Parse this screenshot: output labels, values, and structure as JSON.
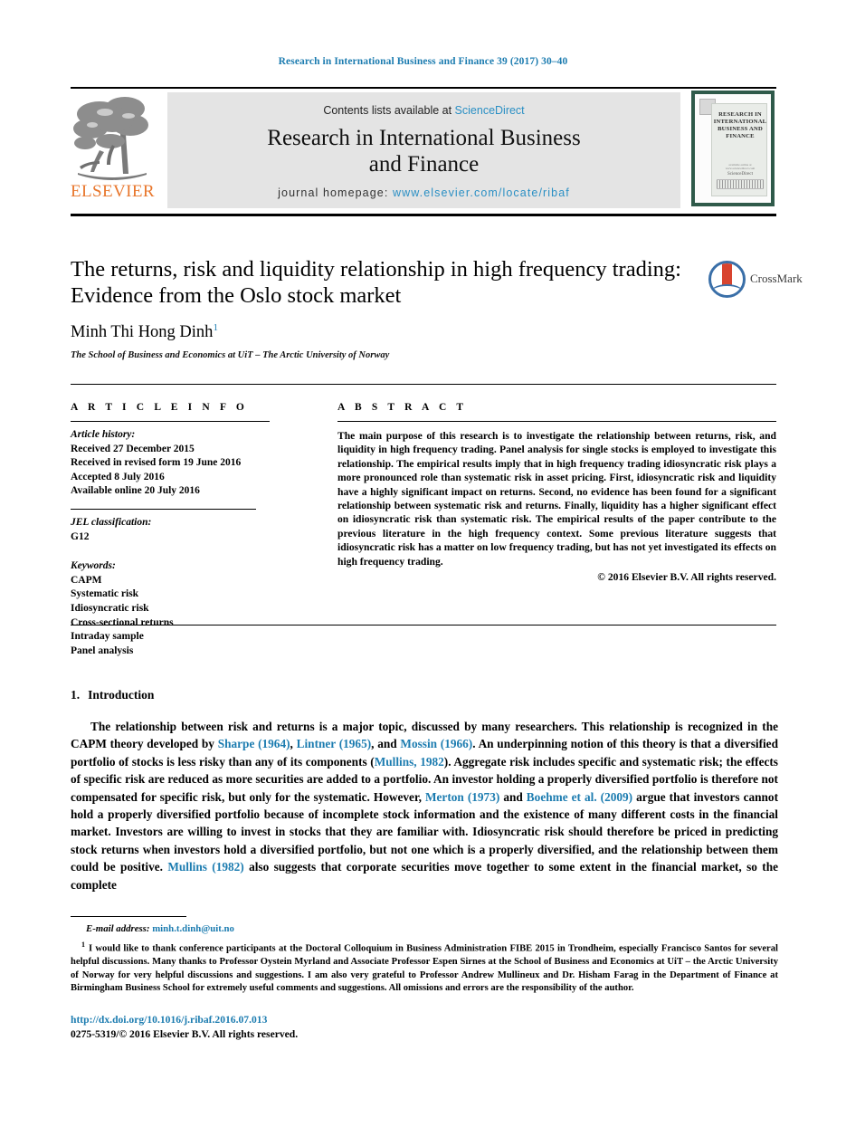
{
  "running_head": "Research in International Business and Finance 39 (2017) 30–40",
  "masthead": {
    "publisher_name": "ELSEVIER",
    "contents_prefix": "Contents lists available at ",
    "contents_link": "ScienceDirect",
    "journal_title_line1": "Research in International Business",
    "journal_title_line2": "and Finance",
    "homepage_prefix": "journal homepage: ",
    "homepage_url": "www.elsevier.com/locate/ribaf",
    "cover": {
      "title_line1": "RESEARCH IN",
      "title_line2": "INTERNATIONAL",
      "title_line3": "BUSINESS AND",
      "title_line4": "FINANCE",
      "footer_tiny": "available online at www.sciencedirect.com",
      "footer_sciencedirect": "ScienceDirect"
    }
  },
  "article": {
    "title": "The returns, risk and liquidity relationship in high frequency trading: Evidence from the Oslo stock market",
    "author": "Minh Thi Hong Dinh",
    "author_footnote_marker": "1",
    "affiliation": "The School of Business and Economics at UiT – The Arctic University of Norway",
    "crossmark_label": "CrossMark"
  },
  "article_info": {
    "heading": "A R T I C L E   I N F O",
    "history_label": "Article history:",
    "history": [
      "Received 27 December 2015",
      "Received in revised form 19 June 2016",
      "Accepted 8 July 2016",
      "Available online 20 July 2016"
    ],
    "jel_label": "JEL classification:",
    "jel_codes": [
      "G12"
    ],
    "keywords_label": "Keywords:",
    "keywords": [
      "CAPM",
      "Systematic risk",
      "Idiosyncratic risk",
      "Cross-sectional returns",
      "Intraday sample",
      "Panel analysis"
    ]
  },
  "abstract": {
    "heading": "A B S T R A C T",
    "text": "The main purpose of this research is to investigate the relationship between returns, risk, and liquidity in high frequency trading. Panel analysis for single stocks is employed to investigate this relationship. The empirical results imply that in high frequency trading idiosyncratic risk plays a more pronounced role than systematic risk in asset pricing. First, idiosyncratic risk and liquidity have a highly significant impact on returns. Second, no evidence has been found for a significant relationship between systematic risk and returns. Finally, liquidity has a higher significant effect on idiosyncratic risk than systematic risk. The empirical results of the paper contribute to the previous literature in the high frequency context. Some previous literature suggests that idiosyncratic risk has a matter on low frequency trading, but has not yet investigated its effects on high frequency trading.",
    "copyright": "© 2016 Elsevier B.V. All rights reserved."
  },
  "introduction": {
    "number": "1.",
    "heading": "Introduction",
    "paragraph_parts": [
      {
        "t": "The relationship between risk and returns is a major topic, discussed by many researchers. This relationship is recognized in the CAPM theory developed by ",
        "ref": false
      },
      {
        "t": "Sharpe (1964)",
        "ref": true
      },
      {
        "t": ", ",
        "ref": false
      },
      {
        "t": "Lintner (1965)",
        "ref": true
      },
      {
        "t": ", and ",
        "ref": false
      },
      {
        "t": "Mossin (1966)",
        "ref": true
      },
      {
        "t": ". An underpinning notion of this theory is that a diversified portfolio of stocks is less risky than any of its components (",
        "ref": false
      },
      {
        "t": "Mullins, 1982",
        "ref": true
      },
      {
        "t": "). Aggregate risk includes specific and systematic risk; the effects of specific risk are reduced as more securities are added to a portfolio. An investor holding a properly diversified portfolio is therefore not compensated for specific risk, but only for the systematic. However, ",
        "ref": false
      },
      {
        "t": "Merton (1973)",
        "ref": true
      },
      {
        "t": " and ",
        "ref": false
      },
      {
        "t": "Boehme et al. (2009)",
        "ref": true
      },
      {
        "t": " argue that investors cannot hold a properly diversified portfolio because of incomplete stock information and the existence of many different costs in the financial market. Investors are willing to invest in stocks that they are familiar with. Idiosyncratic risk should therefore be priced in predicting stock returns when investors hold a diversified portfolio, but not one which is a properly diversified, and the relationship between them could be positive. ",
        "ref": false
      },
      {
        "t": "Mullins (1982)",
        "ref": true
      },
      {
        "t": " also suggests that corporate securities move together to some extent in the financial market, so the complete",
        "ref": false
      }
    ]
  },
  "footnotes": {
    "email_label": "E-mail address:",
    "email_address": "minh.t.dinh@uit.no",
    "note_marker": "1",
    "note_text": "I would like to thank conference participants at the Doctoral Colloquium in Business Administration FIBE 2015 in Trondheim, especially Francisco Santos for several helpful discussions. Many thanks to Professor Oystein Myrland and Associate Professor Espen Sirnes at the School of Business and Economics at UiT – the Arctic University of Norway for very helpful discussions and suggestions. I am also very grateful to Professor Andrew Mullineux and Dr. Hisham Farag in the Department of Finance at Birmingham Business School for extremely useful comments and suggestions. All omissions and errors are the responsibility of the author.",
    "doi": "http://dx.doi.org/10.1016/j.ribaf.2016.07.013",
    "issn_copyright": "0275-5319/© 2016 Elsevier B.V. All rights reserved."
  },
  "colors": {
    "link_blue": "#1c7cb0",
    "sciencedirect_blue": "#2a8fc4",
    "elsevier_orange": "#e8762c",
    "cover_border_green": "#2f5a4a",
    "crossmark_red": "#d8442f",
    "crossmark_blue": "#3a6fa8"
  }
}
